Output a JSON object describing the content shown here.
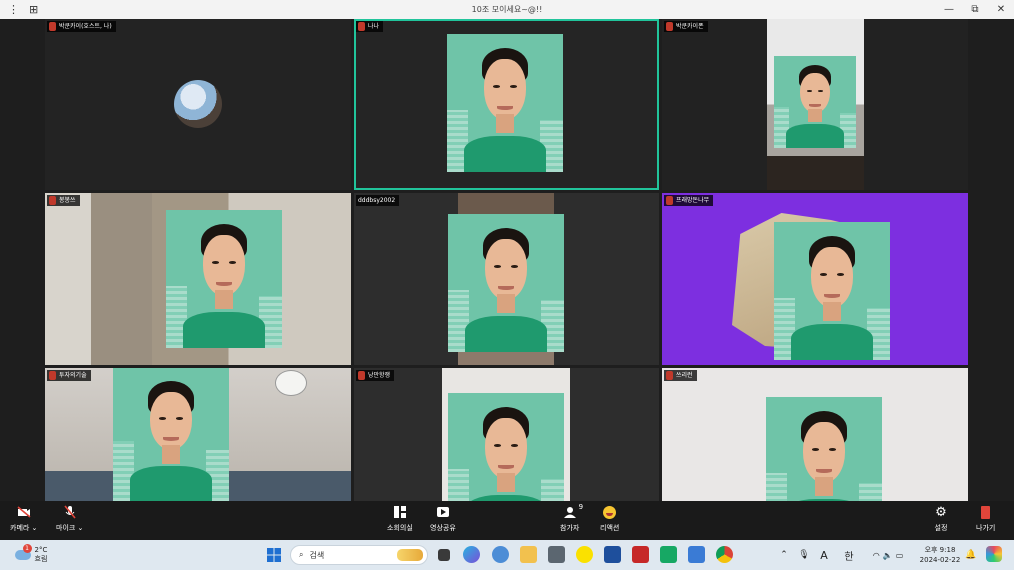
{
  "window": {
    "title": "10조 모이세요~@!!",
    "menu_icon": "more-vertical-icon",
    "layout_icon": "grid-icon",
    "controls": {
      "minimize": "—",
      "restore": "⧉",
      "close": "✕"
    }
  },
  "participants": [
    {
      "name": "박쿤카이(호스트, 나)",
      "muted": true
    },
    {
      "name": "나나",
      "muted": true,
      "speaking": true
    },
    {
      "name": "박쿤카이폰",
      "muted": true
    },
    {
      "name": "봉봉쓰",
      "muted": true
    },
    {
      "name": "dddbsy2002",
      "muted": false
    },
    {
      "name": "프래망돈나무",
      "muted": true
    },
    {
      "name": "투자의기술",
      "muted": true
    },
    {
      "name": "낭만항쟁",
      "muted": true
    },
    {
      "name": "쓰리런",
      "muted": true
    }
  ],
  "controls": {
    "camera": "카메라",
    "mic": "마이크",
    "breakout": "소회의실",
    "share": "영상공유",
    "participants": "참가자",
    "participants_count": "9",
    "reaction": "리액션",
    "settings": "설정",
    "leave": "나가기"
  },
  "taskbar": {
    "weather_temp": "2°C",
    "weather_desc": "흐림",
    "weather_badge": "1",
    "search_placeholder": "검색",
    "tray": {
      "ime_a": "A",
      "ime_han": "한"
    },
    "time": "오후 9:18",
    "date": "2024-02-22"
  },
  "colors": {
    "active_border": "#21c49b",
    "purple_bg": "#7d2fe0",
    "portrait_bg": "#6fc4a8",
    "leave_red": "#e0453a"
  }
}
